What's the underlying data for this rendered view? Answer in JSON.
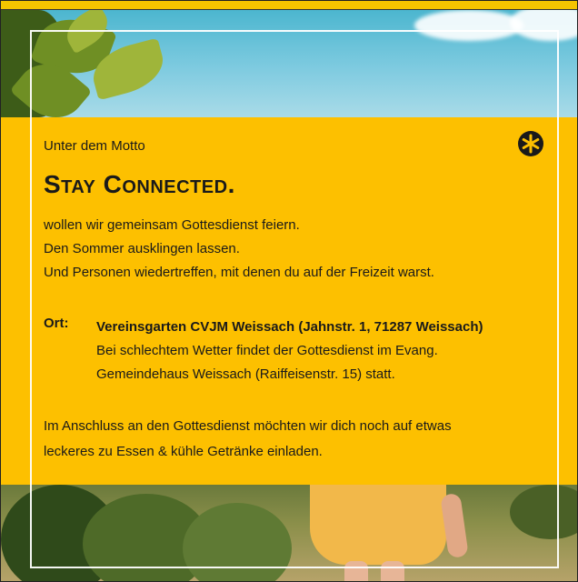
{
  "motto_intro": "Unter dem Motto",
  "headline": "Stay Connected.",
  "intro_lines": [
    "wollen wir gemeinsam Gottesdienst feiern.",
    "Den Sommer ausklingen lassen.",
    "Und Personen wiedertreffen, mit denen du auf der Freizeit warst."
  ],
  "location": {
    "label": "Ort:",
    "venue": "Vereinsgarten CVJM Weissach (Jahnstr. 1, 71287 Weissach)",
    "rain_line_1": "Bei schlechtem Wetter findet der Gottesdienst im Evang.",
    "rain_line_2": "Gemeindehaus Weissach (Raiffeisenstr. 15) statt."
  },
  "closing_lines": [
    "Im Anschluss an den Gottesdienst möchten wir dich noch auf etwas",
    "leckeres zu Essen & kühle Getränke einladen."
  ],
  "colors": {
    "panel_yellow": "#fdc000",
    "text": "#1a1a1a",
    "sky": "#7fcbe0"
  },
  "icons": {
    "corner_icon": "asterisk-circle-icon"
  }
}
